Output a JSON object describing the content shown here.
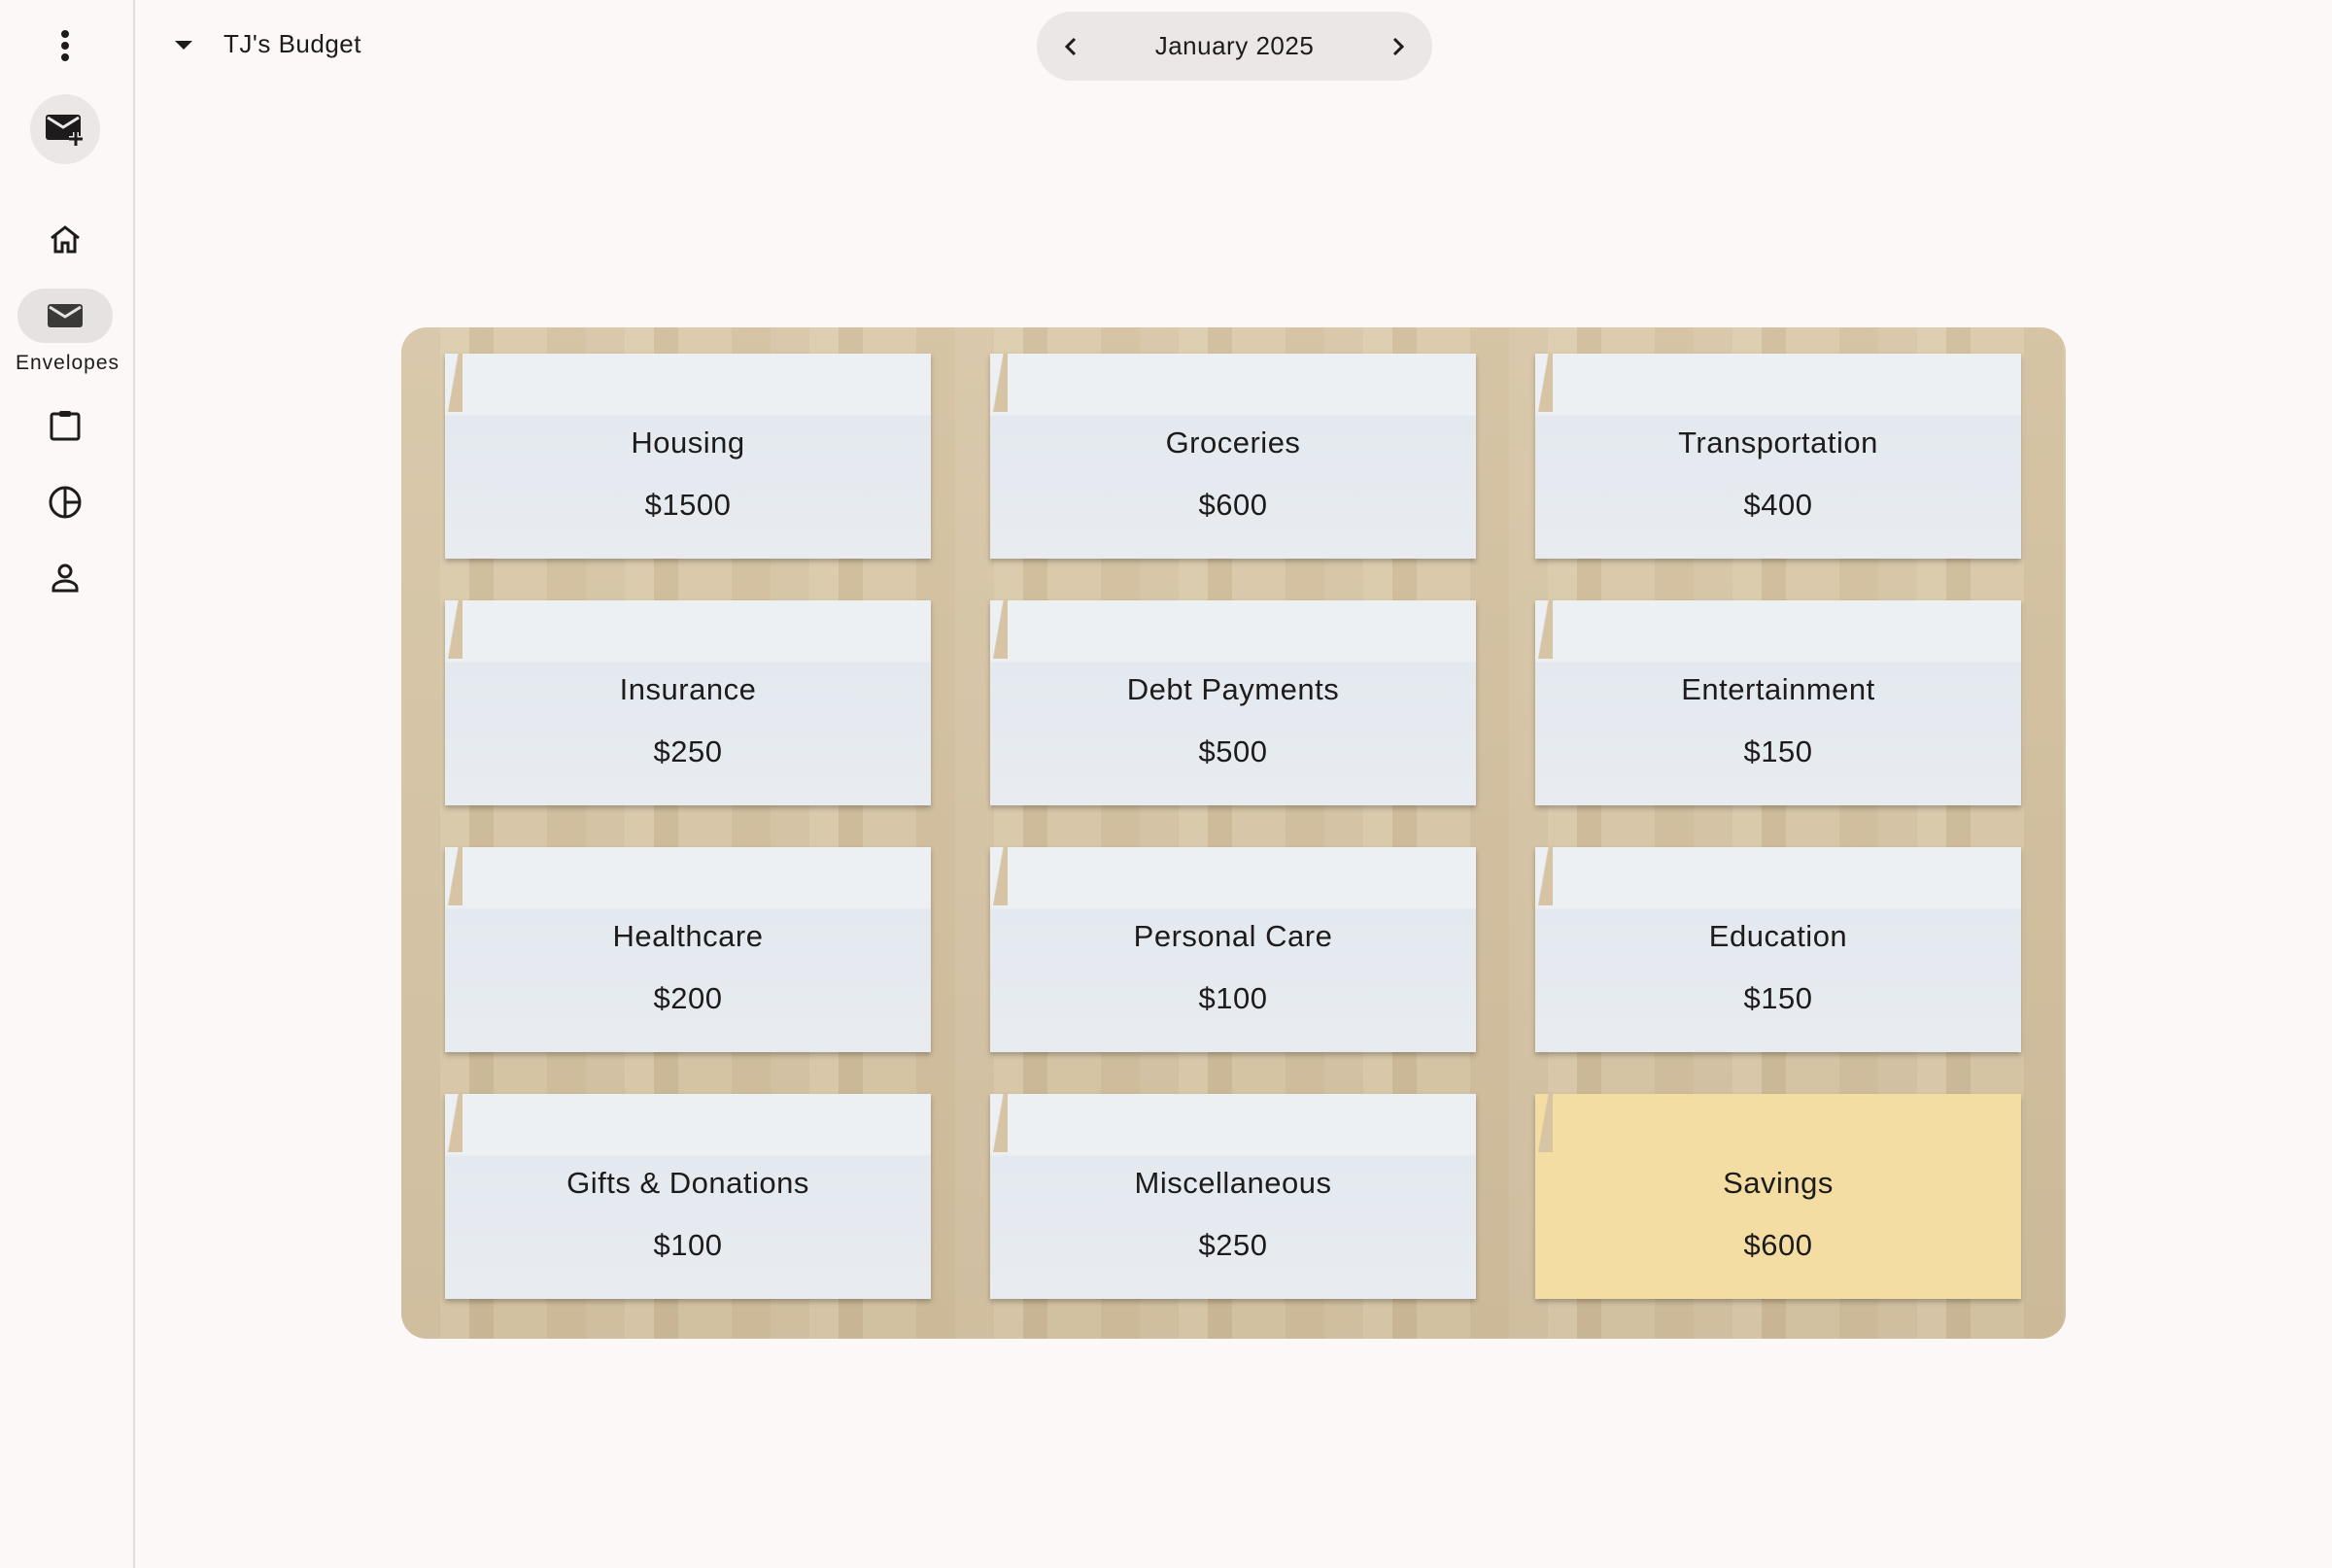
{
  "sidebar": {
    "nav": [
      {
        "label": "Home",
        "icon": "home-icon"
      },
      {
        "label": "Envelopes",
        "icon": "envelope-icon",
        "active": true
      },
      {
        "label": "",
        "icon": "clipboard-icon"
      },
      {
        "label": "",
        "icon": "pie-chart-icon"
      },
      {
        "label": "",
        "icon": "person-icon"
      }
    ],
    "active_label": "Envelopes"
  },
  "header": {
    "budget_name": "TJ's Budget",
    "month": "January 2025"
  },
  "envelopes": [
    {
      "name": "Housing",
      "amount": "$1500"
    },
    {
      "name": "Groceries",
      "amount": "$600"
    },
    {
      "name": "Transportation",
      "amount": "$400"
    },
    {
      "name": "Insurance",
      "amount": "$250"
    },
    {
      "name": "Debt Payments",
      "amount": "$500"
    },
    {
      "name": "Entertainment",
      "amount": "$150"
    },
    {
      "name": "Healthcare",
      "amount": "$200"
    },
    {
      "name": "Personal Care",
      "amount": "$100"
    },
    {
      "name": "Education",
      "amount": "$150"
    },
    {
      "name": "Gifts & Donations",
      "amount": "$100"
    },
    {
      "name": "Miscellaneous",
      "amount": "$250"
    },
    {
      "name": "Savings",
      "amount": "$600",
      "highlight": true
    }
  ],
  "colors": {
    "background": "#fbf8f7",
    "savings_envelope": "#f3dda3",
    "envelope": "#e8ecf1"
  }
}
